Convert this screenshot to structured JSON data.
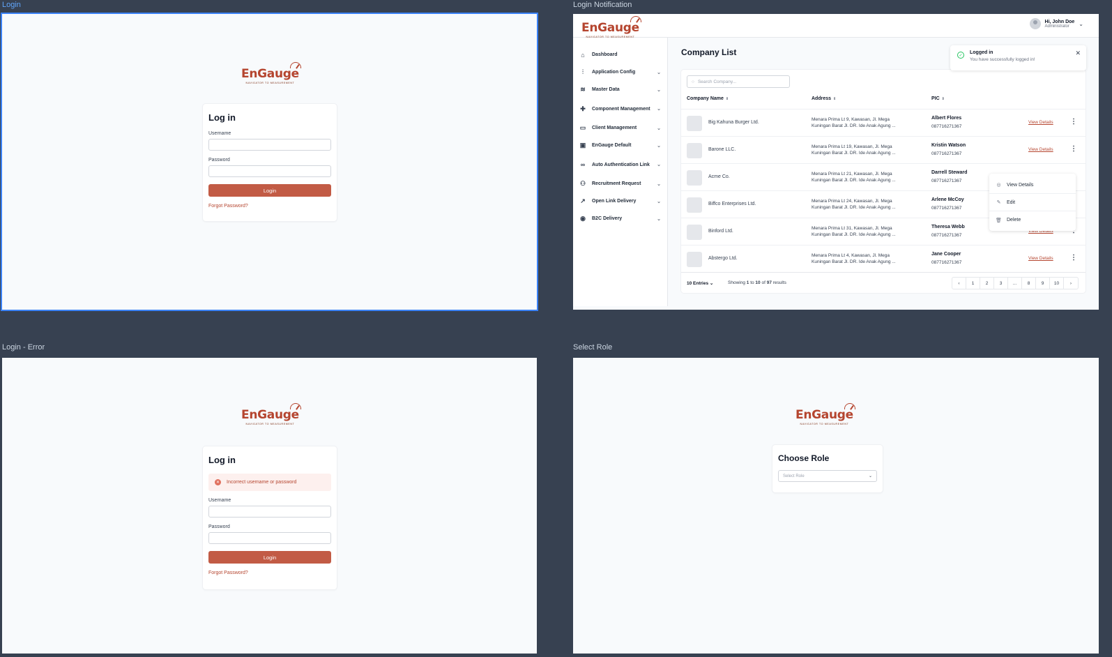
{
  "frames": {
    "login": "Login",
    "notification": "Login Notification",
    "error": "Login - Error",
    "role": "Select Role"
  },
  "brand": {
    "name": "EnGauge",
    "tagline": "NAVIGATOR TO MEASUREMENT",
    "color": "#b5452f"
  },
  "login": {
    "title": "Log in",
    "username_label": "Username",
    "password_label": "Password",
    "button": "Login",
    "forgot": "Forgot Password?"
  },
  "login_error": {
    "title": "Log in",
    "error": "Incorrect username or password",
    "username_label": "Username",
    "password_label": "Password",
    "button": "Login",
    "forgot": "Forgot Password?"
  },
  "dashboard": {
    "user": {
      "name": "Hi, John Doe",
      "role": "Administrator"
    },
    "sidebar": [
      {
        "label": "Dashboard",
        "icon": "home-icon"
      },
      {
        "label": "Application Config",
        "icon": "sliders-icon"
      },
      {
        "label": "Master Data",
        "icon": "database-icon"
      },
      {
        "label": "Component Management",
        "icon": "puzzle-icon"
      },
      {
        "label": "Client Management",
        "icon": "building-icon"
      },
      {
        "label": "EnGauge Default",
        "icon": "briefcase-icon"
      },
      {
        "label": "Auto Authentication Link",
        "icon": "link-icon"
      },
      {
        "label": "Recruitment Request",
        "icon": "users-icon"
      },
      {
        "label": "Open Link Delivery",
        "icon": "external-link-icon"
      },
      {
        "label": "B2C Delivery",
        "icon": "user-circle-icon"
      }
    ],
    "page_title": "Company List",
    "toast": {
      "title": "Logged in",
      "message": "You have successfully logged in!"
    },
    "search_placeholder": "Search Company...",
    "columns": {
      "name": "Company Name",
      "address": "Address",
      "pic": "PIC"
    },
    "rows": [
      {
        "name": "Big Kahuna Burger Ltd.",
        "addr1": "Menara Prima Lt 9, Kawasan, Jl. Mega",
        "addr2": "Kuningan Barat Jl. DR. Ide Anak Agung ...",
        "pic": "Albert Flores",
        "phone": "087716271367",
        "action": "View Details"
      },
      {
        "name": "Barone LLC.",
        "addr1": "Menara Prima Lt 19, Kawasan, Jl. Mega",
        "addr2": "Kuningan Barat Jl. DR. Ide Anak Agung ...",
        "pic": "Kristin Watson",
        "phone": "087716271367",
        "action": "View Details"
      },
      {
        "name": "Acme Co.",
        "addr1": "Menara Prima Lt 21, Kawasan, Jl. Mega",
        "addr2": "Kuningan Barat Jl. DR. Ide Anak Agung ...",
        "pic": "Darrell Steward",
        "phone": "087716271367",
        "action": ""
      },
      {
        "name": "Biffco Enterprises Ltd.",
        "addr1": "Menara Prima Lt 24, Kawasan, Jl. Mega",
        "addr2": "Kuningan Barat Jl. DR. Ide Anak Agung ...",
        "pic": "Arlene McCoy",
        "phone": "087716271367",
        "action": ""
      },
      {
        "name": "Binford Ltd.",
        "addr1": "Menara Prima Lt 31, Kawasan, Jl. Mega",
        "addr2": "Kuningan Barat Jl. DR. Ide Anak Agung ...",
        "pic": "Theresa Webb",
        "phone": "087716271367",
        "action": "View Details"
      },
      {
        "name": "Abstergo Ltd.",
        "addr1": "Menara Prima Lt 4, Kawasan, Jl. Mega",
        "addr2": "Kuningan Barat Jl. DR. Ide Anak Agung ...",
        "pic": "Jane Cooper",
        "phone": "087716271367",
        "action": "View Details"
      }
    ],
    "menu": [
      "View Details",
      "Edit",
      "Delete"
    ],
    "footer": {
      "entries": "10 Entries",
      "showing_prefix": "Showing",
      "from": "1",
      "to_word": "to",
      "to": "10",
      "of_word": "of",
      "total": "97",
      "suffix": "results"
    },
    "pages": [
      "1",
      "2",
      "3",
      "...",
      "8",
      "9",
      "10"
    ]
  },
  "select_role": {
    "title": "Choose Role",
    "placeholder": "Select Role"
  }
}
